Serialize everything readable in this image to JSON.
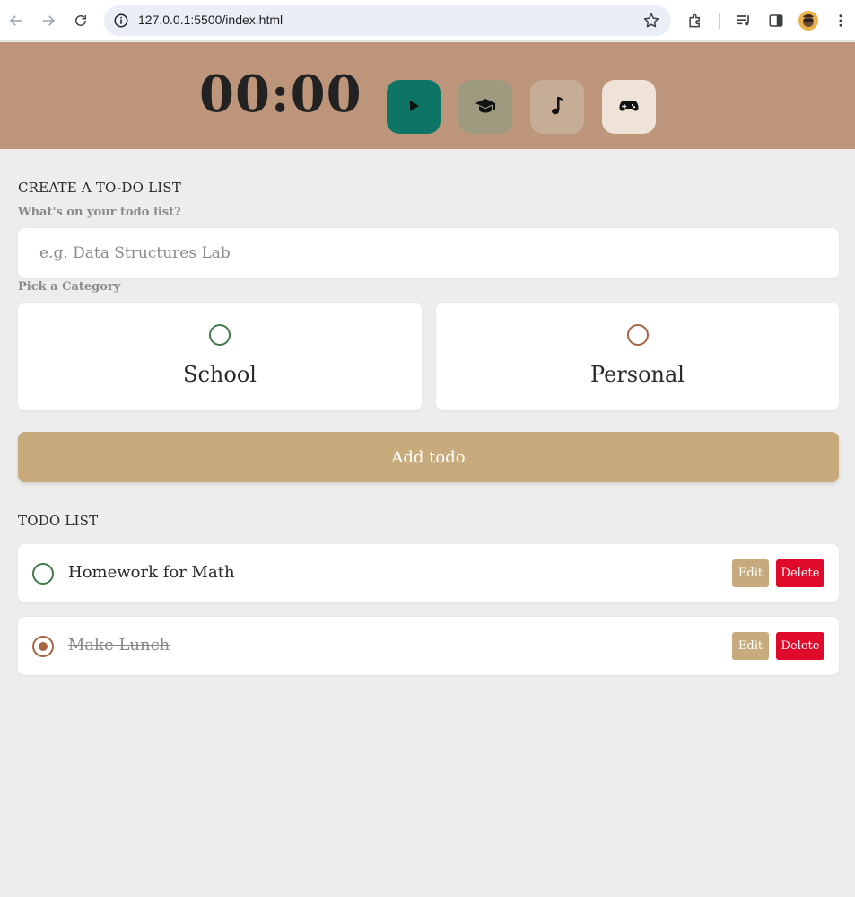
{
  "browser": {
    "url": "127.0.0.1:5500/index.html",
    "icons": [
      "back-arrow-icon",
      "forward-arrow-icon",
      "reload-icon",
      "info-icon",
      "star-icon",
      "extensions-icon",
      "media-icon",
      "side-panel-icon",
      "avatar",
      "menu-icon"
    ]
  },
  "header": {
    "timer": "00:00",
    "buttons": [
      "play-icon",
      "graduation-cap-icon",
      "music-note-icon",
      "gamepad-icon"
    ],
    "colors": {
      "background": "#bd957b",
      "play": "#0e7566",
      "study": "#9d9a80",
      "music": "#c6ad96",
      "game": "#efe2d7"
    }
  },
  "form": {
    "title": "CREATE A TO-DO LIST",
    "input_label": "What's on your todo list?",
    "input_placeholder": "e.g. Data Structures Lab",
    "input_value": "",
    "category_label": "Pick a Category",
    "categories": [
      {
        "label": "School",
        "selected": false,
        "color": "#3f7a4a"
      },
      {
        "label": "Personal",
        "selected": false,
        "color": "#a8633f"
      }
    ],
    "add_button": "Add todo"
  },
  "todo_list": {
    "title": "TODO LIST",
    "items": [
      {
        "text": "Homework for Math",
        "done": false,
        "category": "School",
        "edit_label": "Edit",
        "delete_label": "Delete"
      },
      {
        "text": "Make Lunch",
        "done": true,
        "category": "Personal",
        "edit_label": "Edit",
        "delete_label": "Delete"
      }
    ]
  }
}
